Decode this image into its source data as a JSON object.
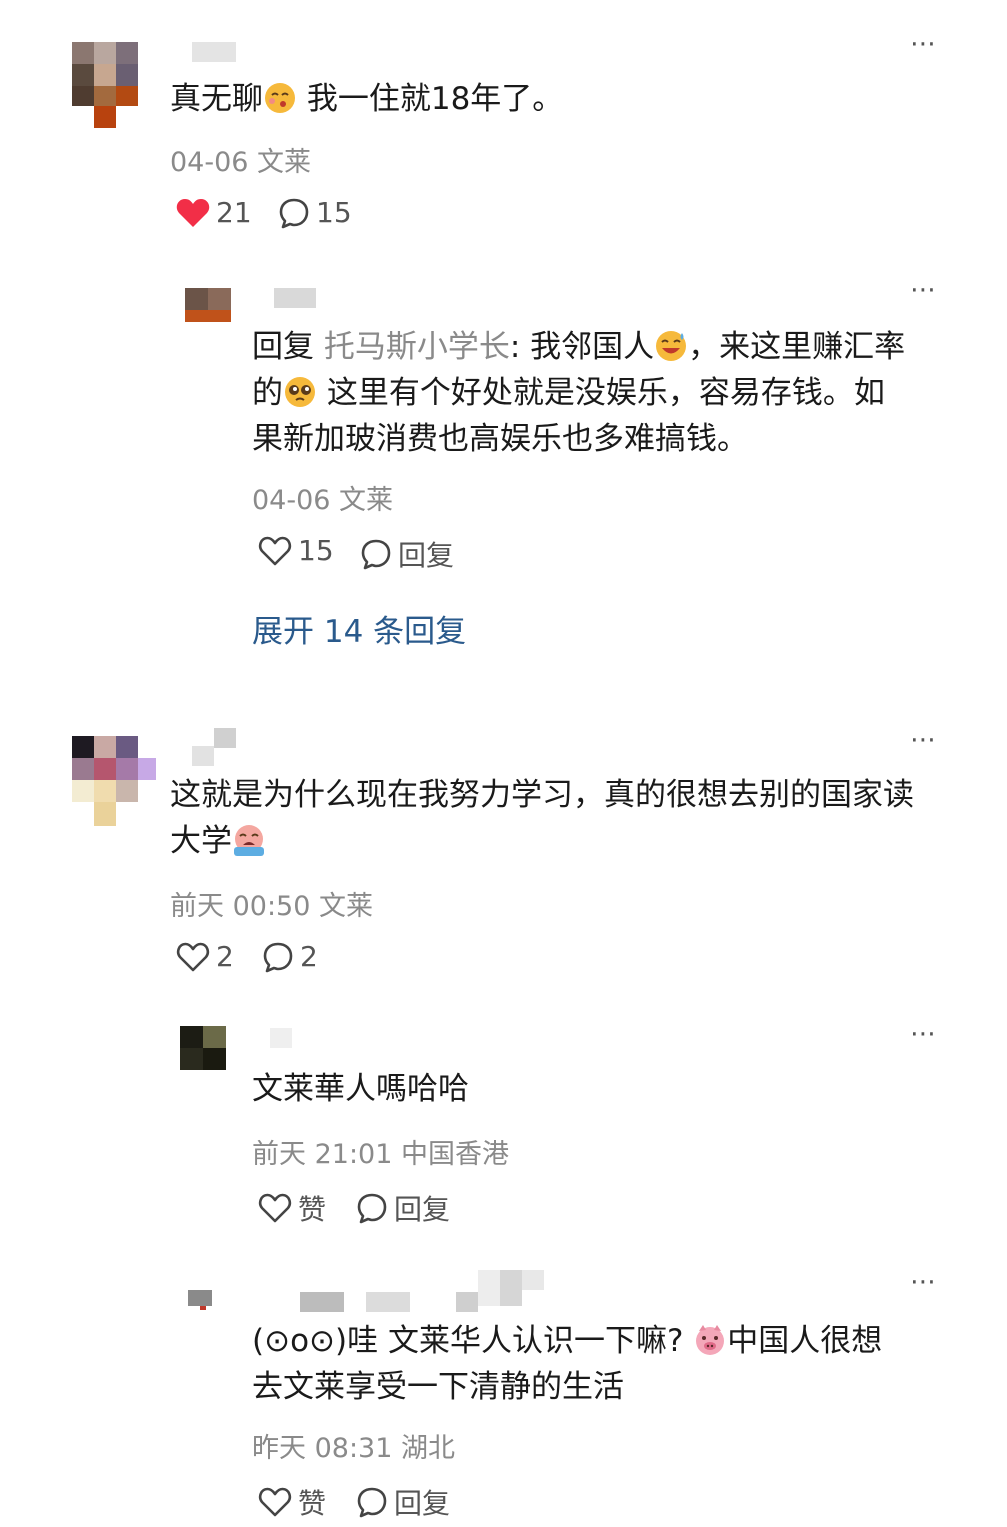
{
  "comments": [
    {
      "text_before": "真无聊",
      "text_after": " 我一住就18年了。",
      "meta": "04-06 文莱",
      "likes": "21",
      "replies": "15",
      "liked": true,
      "reply": {
        "reply_prefix": "回复 ",
        "reply_to": "托马斯小学长",
        "line1_a": ": 我邻国人",
        "line1_b": "，来这里赚汇率",
        "line2_a": "的",
        "line2_b": " 这里有个好处就是没娱乐，容易存钱。如",
        "line3": "果新加玻消费也高娱乐也多难搞钱。",
        "meta": "04-06 文莱",
        "likes": "15",
        "reply_label": "回复"
      },
      "expand_label": "展开 14 条回复"
    },
    {
      "line1": "这就是为什么现在我努力学习，真的很想去别的国家读",
      "line2": "大学",
      "meta": "前天 00:50 文莱",
      "likes": "2",
      "replies": "2",
      "replies_list": [
        {
          "text": "文莱華人嗎哈哈",
          "meta": "前天 21:01 中国香港",
          "like_label": "赞",
          "reply_label": "回复"
        },
        {
          "line1_a": "(⊙o⊙)哇 文莱华人认识一下嘛?",
          "line1_b": "中国人很想",
          "line2": "去文莱享受一下清静的生活",
          "meta": "昨天 08:31 湖北",
          "like_label": "赞",
          "reply_label": "回复"
        }
      ]
    }
  ],
  "more_icon": "⋯",
  "colors": {
    "like_red": "#f22e47",
    "link_blue": "#2a5a8c",
    "meta_gray": "#8a8a8a"
  }
}
